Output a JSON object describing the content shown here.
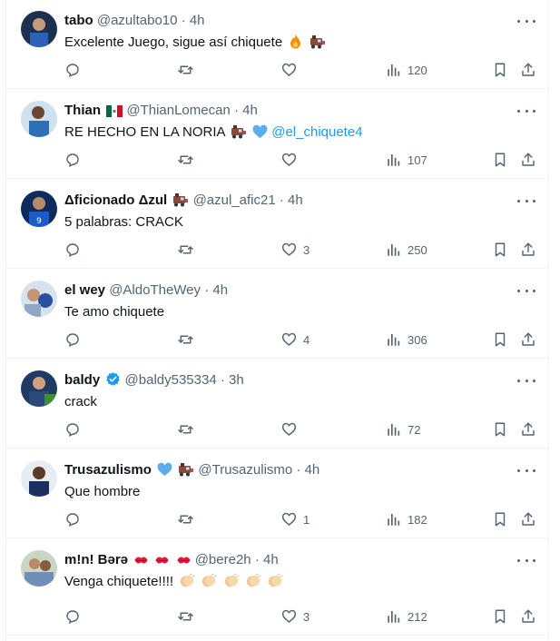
{
  "replies": [
    {
      "name": "tabo",
      "handle": "@azultabo10",
      "time": "4h",
      "text": "Excelente Juego, sigue así chiquete",
      "mention": "",
      "likes": "",
      "views": "120",
      "avatar_color": "#1d3050"
    },
    {
      "name": "Thian",
      "handle": "@ThianLomecan",
      "time": "4h",
      "text": "RE HECHO EN LA NORIA",
      "mention": "@el_chiquete4",
      "likes": "",
      "views": "107",
      "avatar_color": "#2f6fb5"
    },
    {
      "name": "Δficionado Δzul",
      "handle": "@azul_afic21",
      "time": "4h",
      "text": "5 palabras: CRACK",
      "mention": "",
      "likes": "3",
      "views": "250",
      "avatar_color": "#1e3f8a"
    },
    {
      "name": "el wey",
      "handle": "@AldoTheWey",
      "time": "4h",
      "text": "Te amo chiquete",
      "mention": "",
      "likes": "4",
      "views": "306",
      "avatar_color": "#8fa6c7"
    },
    {
      "name": "baldy",
      "handle": "@baldy535334",
      "time": "3h",
      "text": "crack",
      "mention": "",
      "likes": "",
      "views": "72",
      "avatar_color": "#2b4a7a"
    },
    {
      "name": "Trusazulismo",
      "handle": "@Trusazulismo",
      "time": "4h",
      "text": "Que hombre",
      "mention": "",
      "likes": "1",
      "views": "182",
      "avatar_color": "#1c2f5e"
    },
    {
      "name": "m!n! Bərə",
      "handle": "@bere2h",
      "time": "4h",
      "text": "Venga chiquete!!!!",
      "mention": "",
      "likes": "3",
      "views": "212",
      "avatar_color": "#6f8fb8"
    }
  ],
  "colors": {
    "text": "#0f1419",
    "secondary": "#536471",
    "link": "#1d9bf0",
    "border": "#eff3f4"
  }
}
